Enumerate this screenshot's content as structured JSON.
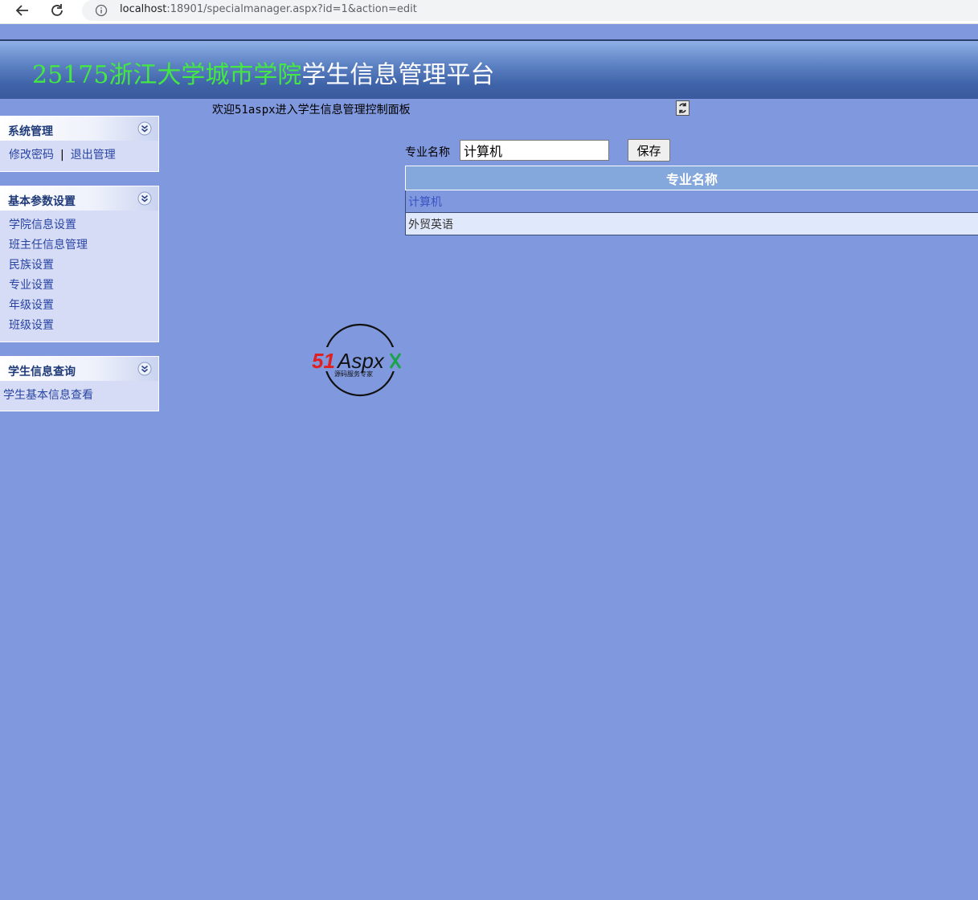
{
  "browser": {
    "url_host": "localhost",
    "url_rest": ":18901/specialmanager.aspx?id=1&action=edit"
  },
  "header": {
    "title_green": "25175浙江大学城市学院",
    "title_white": "学生信息管理平台"
  },
  "welcome_text": "欢迎51aspx进入学生信息管理控制面板",
  "sidebar": {
    "system": {
      "title": "系统管理",
      "links": [
        "修改密码",
        "退出管理"
      ],
      "separator": "|"
    },
    "basic": {
      "title": "基本参数设置",
      "items": [
        "学院信息设置",
        "班主任信息管理",
        "民族设置",
        "专业设置",
        "年级设置",
        "班级设置"
      ]
    },
    "student": {
      "title": "学生信息查询",
      "items": [
        "学生基本信息查看"
      ]
    }
  },
  "form": {
    "label": "专业名称",
    "value": "计算机",
    "save_label": "保存"
  },
  "table": {
    "header": "专业名称",
    "rows": [
      "计算机",
      "外贸英语"
    ]
  },
  "logo": {
    "brand_red": "51",
    "brand_black": "Aspx",
    "tagline": "源码服务专家"
  },
  "colors": {
    "background": "#8098de",
    "title_green": "#43e843",
    "link": "#2844a3"
  }
}
